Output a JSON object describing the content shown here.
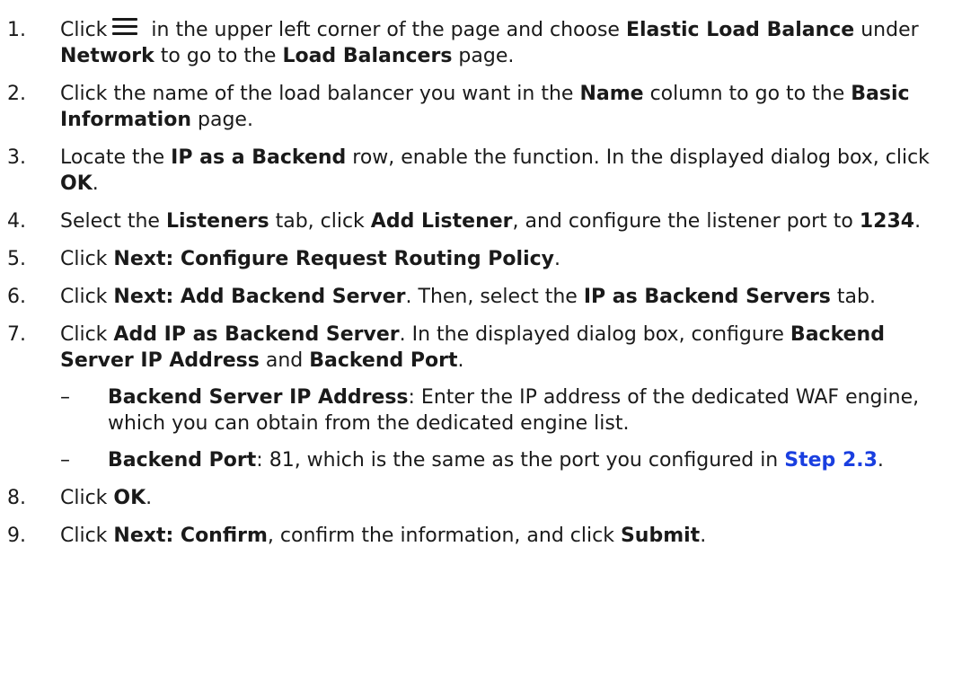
{
  "steps": [
    {
      "num": "1.",
      "click": "Click",
      "icon": "menu-icon",
      "t1": " in the upper left corner of the page and choose ",
      "b1": "Elastic Load Balance",
      "t2": " under ",
      "b2": "Network",
      "t3": " to go to the ",
      "b3": "Load Balancers",
      "t4": " page."
    },
    {
      "num": "2.",
      "t1": "Click the name of the load balancer you want in the ",
      "b1": "Name",
      "t2": " column to go to the ",
      "b2": "Basic Information",
      "t3": " page."
    },
    {
      "num": "3.",
      "t1": "Locate the ",
      "b1": "IP as a Backend",
      "t2": " row, enable the function. In the displayed dialog box, click ",
      "b2": "OK",
      "t3": "."
    },
    {
      "num": "4.",
      "t1": "Select the ",
      "b1": "Listeners",
      "t2": " tab, click ",
      "b2": "Add Listener",
      "t3": ", and configure the listener port to ",
      "b3": "1234",
      "t4": "."
    },
    {
      "num": "5.",
      "t1": "Click ",
      "b1": "Next: Configure Request Routing Policy",
      "t2": "."
    },
    {
      "num": "6.",
      "t1": "Click ",
      "b1": "Next: Add Backend Server",
      "t2": ". Then, select the ",
      "b2": "IP as Backend Servers",
      "t3": " tab."
    },
    {
      "num": "7.",
      "t1": "Click ",
      "b1": "Add IP as Backend Server",
      "t2": ". In the displayed dialog box, configure ",
      "b2": "Backend Server IP Address",
      "t3": " and ",
      "b3": "Backend Port",
      "t4": ".",
      "sub": [
        {
          "dash": "–",
          "b1": "Backend Server IP Address",
          "t1": ": Enter the IP address of the dedicated WAF engine, which you can obtain from the dedicated engine list."
        },
        {
          "dash": "–",
          "b1": "Backend Port",
          "t1": ": 81, which is the same as the port you configured in ",
          "link": "Step 2.3",
          "t2": "."
        }
      ]
    },
    {
      "num": "8.",
      "t1": "Click ",
      "b1": "OK",
      "t2": "."
    },
    {
      "num": "9.",
      "t1": "Click ",
      "b1": "Next: Confirm",
      "t2": ", confirm the information, and click ",
      "b2": "Submit",
      "t3": "."
    }
  ],
  "colors": {
    "text": "#1a1a1a",
    "link": "#1a3fe0"
  }
}
